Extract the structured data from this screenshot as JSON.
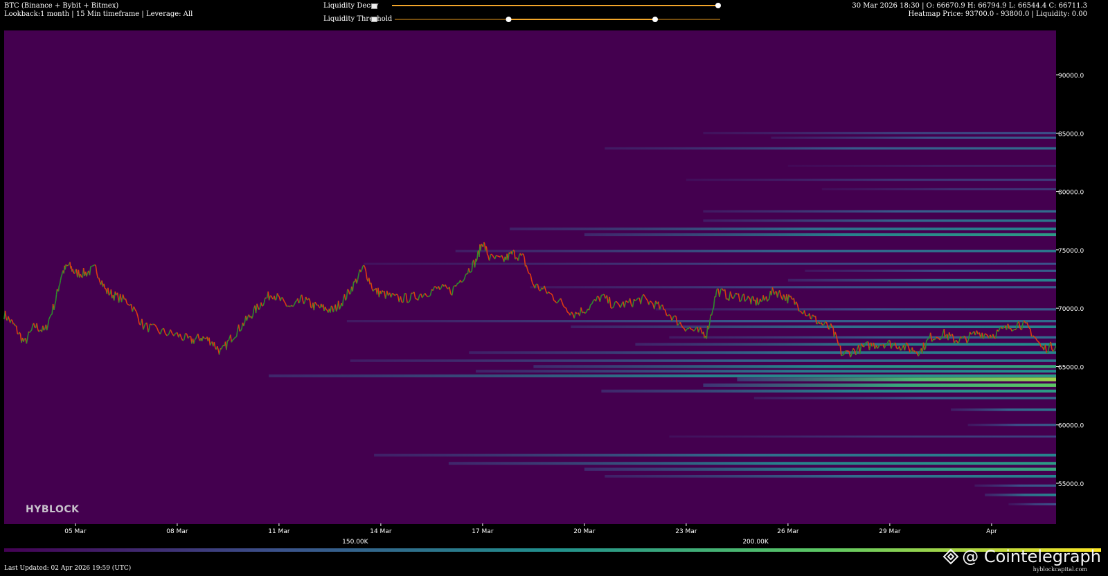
{
  "header": {
    "title": "BTC (Binance + Bybit + Bitmex)",
    "subtitle": "Lookback:1 month | 15 Min timeframe | Leverage: All",
    "ohlc": "30 Mar 2026 18:30 | O: 66670.9 H: 66794.9 L: 66544.4 C: 66711.3",
    "heatmap_info": "Heatmap Price: 93700.0 - 93800.0 | Liquidity: 0.00"
  },
  "controls": {
    "decay_label": "Liquidity Decay",
    "threshold_label": "Liquidity Threshold",
    "decay_value": 1.0,
    "threshold_range": [
      0.35,
      0.8
    ]
  },
  "colorbar": {
    "ticks": [
      {
        "label": "150.00K",
        "pos": 0.32
      },
      {
        "label": "200.00K",
        "pos": 0.685
      }
    ]
  },
  "footer": {
    "updated": "Last Updated: 02 Apr 2026 19:59 (UTC)",
    "site": "hyblockcapital.com",
    "watermark": "@ Cointelegraph",
    "logo": "HYBLOCK"
  },
  "colors": {
    "background": "#44004f",
    "up": "#2e8b2e",
    "down": "#e03a10",
    "viridis": [
      "#440154",
      "#3b528b",
      "#21908d",
      "#5dc863",
      "#fde725"
    ]
  },
  "chart_data": {
    "type": "heatmap",
    "x_ticks": [
      "05 Mar",
      "08 Mar",
      "11 Mar",
      "14 Mar",
      "17 Mar",
      "20 Mar",
      "23 Mar",
      "26 Mar",
      "29 Mar",
      "Apr"
    ],
    "y_ticks": [
      "90000.0",
      "85000.0",
      "80000.0",
      "75000.0",
      "70000.0",
      "65000.0",
      "60000.0",
      "55000.0"
    ],
    "x_range": [
      2.9,
      33.9
    ],
    "y_range": [
      51500,
      93800
    ],
    "price_path": [
      [
        2.9,
        69500
      ],
      [
        3.2,
        68500
      ],
      [
        3.5,
        67000
      ],
      [
        3.8,
        68500
      ],
      [
        4.1,
        68000
      ],
      [
        4.4,
        70500
      ],
      [
        4.6,
        73000
      ],
      [
        4.8,
        73700
      ],
      [
        5.0,
        73000
      ],
      [
        5.3,
        73000
      ],
      [
        5.6,
        73400
      ],
      [
        5.9,
        71500
      ],
      [
        6.2,
        71000
      ],
      [
        6.6,
        70500
      ],
      [
        7.0,
        68500
      ],
      [
        7.5,
        68000
      ],
      [
        8.0,
        67700
      ],
      [
        8.4,
        67200
      ],
      [
        8.7,
        67500
      ],
      [
        9.0,
        67200
      ],
      [
        9.3,
        66200
      ],
      [
        9.6,
        67500
      ],
      [
        9.9,
        68500
      ],
      [
        10.2,
        69500
      ],
      [
        10.5,
        70500
      ],
      [
        10.8,
        71300
      ],
      [
        11.1,
        70500
      ],
      [
        11.4,
        70000
      ],
      [
        11.7,
        70800
      ],
      [
        12.0,
        70200
      ],
      [
        12.3,
        70000
      ],
      [
        12.6,
        69800
      ],
      [
        12.9,
        70700
      ],
      [
        13.2,
        72000
      ],
      [
        13.5,
        73500
      ],
      [
        13.8,
        71500
      ],
      [
        14.1,
        71200
      ],
      [
        14.5,
        70800
      ],
      [
        14.9,
        70900
      ],
      [
        15.3,
        71300
      ],
      [
        15.7,
        71700
      ],
      [
        16.1,
        71500
      ],
      [
        16.5,
        73000
      ],
      [
        16.8,
        74000
      ],
      [
        17.0,
        75700
      ],
      [
        17.2,
        74300
      ],
      [
        17.6,
        74100
      ],
      [
        17.9,
        74700
      ],
      [
        18.2,
        74300
      ],
      [
        18.5,
        72000
      ],
      [
        18.9,
        71400
      ],
      [
        19.3,
        70500
      ],
      [
        19.7,
        69500
      ],
      [
        20.1,
        70000
      ],
      [
        20.5,
        71000
      ],
      [
        20.9,
        70200
      ],
      [
        21.3,
        70400
      ],
      [
        21.7,
        70800
      ],
      [
        22.1,
        70300
      ],
      [
        22.5,
        69500
      ],
      [
        22.9,
        68500
      ],
      [
        23.3,
        68000
      ],
      [
        23.6,
        67800
      ],
      [
        23.9,
        71500
      ],
      [
        24.3,
        71000
      ],
      [
        24.7,
        71000
      ],
      [
        25.0,
        70500
      ],
      [
        25.3,
        70700
      ],
      [
        25.6,
        71500
      ],
      [
        25.9,
        71000
      ],
      [
        26.2,
        70500
      ],
      [
        26.6,
        69500
      ],
      [
        26.9,
        68800
      ],
      [
        27.3,
        68200
      ],
      [
        27.6,
        66000
      ],
      [
        28.0,
        66400
      ],
      [
        28.4,
        66800
      ],
      [
        28.8,
        67000
      ],
      [
        29.2,
        66900
      ],
      [
        29.6,
        66500
      ],
      [
        29.9,
        66300
      ],
      [
        30.2,
        67500
      ],
      [
        30.6,
        67800
      ],
      [
        30.9,
        67300
      ],
      [
        31.2,
        67300
      ],
      [
        31.6,
        67900
      ],
      [
        32.0,
        67700
      ],
      [
        32.4,
        68200
      ],
      [
        32.8,
        68700
      ],
      [
        33.1,
        68300
      ],
      [
        33.5,
        66500
      ],
      [
        33.9,
        66800
      ]
    ],
    "bands": [
      {
        "price": 85000,
        "start": 23.5,
        "level": 0.25
      },
      {
        "price": 84600,
        "start": 25.5,
        "level": 0.3
      },
      {
        "price": 83700,
        "start": 20.6,
        "level": 0.35
      },
      {
        "price": 82200,
        "start": 26.0,
        "level": 0.12
      },
      {
        "price": 81000,
        "start": 23.0,
        "level": 0.2
      },
      {
        "price": 80200,
        "start": 27.0,
        "level": 0.18
      },
      {
        "price": 78300,
        "start": 23.5,
        "level": 0.35
      },
      {
        "price": 77500,
        "start": 23.5,
        "level": 0.4
      },
      {
        "price": 76800,
        "start": 17.8,
        "level": 0.45
      },
      {
        "price": 76300,
        "start": 20.0,
        "level": 0.55
      },
      {
        "price": 74900,
        "start": 16.2,
        "level": 0.4
      },
      {
        "price": 73800,
        "start": 13.5,
        "level": 0.25
      },
      {
        "price": 73200,
        "start": 26.5,
        "level": 0.3
      },
      {
        "price": 72400,
        "start": 26.0,
        "level": 0.45
      },
      {
        "price": 71800,
        "start": 18.4,
        "level": 0.3
      },
      {
        "price": 69900,
        "start": 22.1,
        "level": 0.3
      },
      {
        "price": 68900,
        "start": 13.0,
        "level": 0.35
      },
      {
        "price": 68400,
        "start": 19.6,
        "level": 0.45
      },
      {
        "price": 67500,
        "start": 22.5,
        "level": 0.35
      },
      {
        "price": 66900,
        "start": 21.5,
        "level": 0.5
      },
      {
        "price": 66200,
        "start": 16.6,
        "level": 0.45
      },
      {
        "price": 65500,
        "start": 13.1,
        "level": 0.4
      },
      {
        "price": 65000,
        "start": 18.5,
        "level": 0.6
      },
      {
        "price": 64600,
        "start": 16.8,
        "level": 0.5
      },
      {
        "price": 64200,
        "start": 10.7,
        "level": 0.55
      },
      {
        "price": 63900,
        "start": 24.5,
        "level": 0.85
      },
      {
        "price": 63400,
        "start": 23.5,
        "level": 0.75
      },
      {
        "price": 62900,
        "start": 20.5,
        "level": 0.55
      },
      {
        "price": 62300,
        "start": 25.0,
        "level": 0.35
      },
      {
        "price": 61300,
        "start": 30.8,
        "level": 0.4
      },
      {
        "price": 60000,
        "start": 31.3,
        "level": 0.3
      },
      {
        "price": 59000,
        "start": 22.5,
        "level": 0.2
      },
      {
        "price": 57400,
        "start": 13.8,
        "level": 0.45
      },
      {
        "price": 56700,
        "start": 16.0,
        "level": 0.55
      },
      {
        "price": 56200,
        "start": 20.0,
        "level": 0.6
      },
      {
        "price": 55600,
        "start": 20.6,
        "level": 0.45
      },
      {
        "price": 54800,
        "start": 31.5,
        "level": 0.3
      },
      {
        "price": 54000,
        "start": 31.8,
        "level": 0.45
      },
      {
        "price": 53200,
        "start": 32.5,
        "level": 0.25
      }
    ]
  }
}
